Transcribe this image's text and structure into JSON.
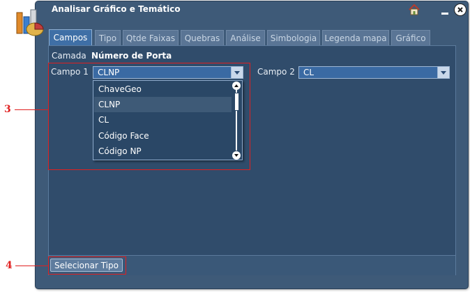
{
  "window": {
    "title": "Analisar Gráfico e Temático"
  },
  "tabs": [
    "Campos",
    "Tipo",
    "Qtde Faixas",
    "Quebras",
    "Análise",
    "Simbologia",
    "Legenda mapa",
    "Gráfico"
  ],
  "active_tab": "Campos",
  "camada": {
    "label": "Camada",
    "value": "Número de Porta"
  },
  "campo1": {
    "label": "Campo 1",
    "value": "CLNP",
    "options": [
      "ChaveGeo",
      "CLNP",
      "CL",
      "Código Face",
      "Código NP"
    ],
    "highlighted": "CLNP"
  },
  "campo2": {
    "label": "Campo 2",
    "value": "CL"
  },
  "buttons": {
    "select_type": "Selecionar Tipo"
  },
  "annotations": {
    "a3": "3",
    "a4": "4"
  },
  "colors": {
    "window": "#3e5a78",
    "panel": "#304c6b",
    "accent": "#3a6aa3",
    "annotation": "#e02020"
  },
  "icons": [
    "app-chart-icon",
    "home-icon",
    "minimize-icon",
    "close-icon",
    "scroll-up-icon",
    "scroll-down-icon"
  ]
}
